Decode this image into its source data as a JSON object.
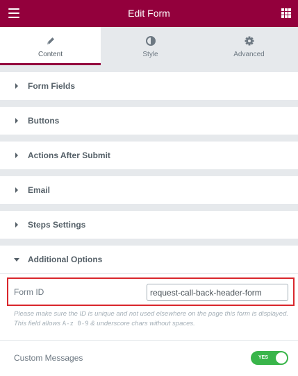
{
  "header": {
    "title": "Edit Form",
    "menu_icon": "hamburger-icon",
    "grid_icon": "grid-icon",
    "color": "#93003c"
  },
  "tabs": [
    {
      "label": "Content",
      "icon": "pencil-icon",
      "active": true
    },
    {
      "label": "Style",
      "icon": "half-circle-icon",
      "active": false
    },
    {
      "label": "Advanced",
      "icon": "gear-icon",
      "active": false
    }
  ],
  "sections": [
    {
      "label": "Form Fields",
      "expanded": false
    },
    {
      "label": "Buttons",
      "expanded": false
    },
    {
      "label": "Actions After Submit",
      "expanded": false
    },
    {
      "label": "Email",
      "expanded": false
    },
    {
      "label": "Steps Settings",
      "expanded": false
    },
    {
      "label": "Additional Options",
      "expanded": true
    }
  ],
  "additional_options": {
    "form_id": {
      "label": "Form ID",
      "value": "request-call-back-header-form",
      "note_text_1": "Please make sure the ID is unique and not used elsewhere on the page this form is displayed. This field allows ",
      "note_code": "A-z 0-9",
      "note_text_2": " & underscore chars without spaces."
    },
    "custom_messages": {
      "label": "Custom Messages",
      "toggle_text": "YES",
      "enabled": true,
      "color": "#39b54a"
    }
  }
}
